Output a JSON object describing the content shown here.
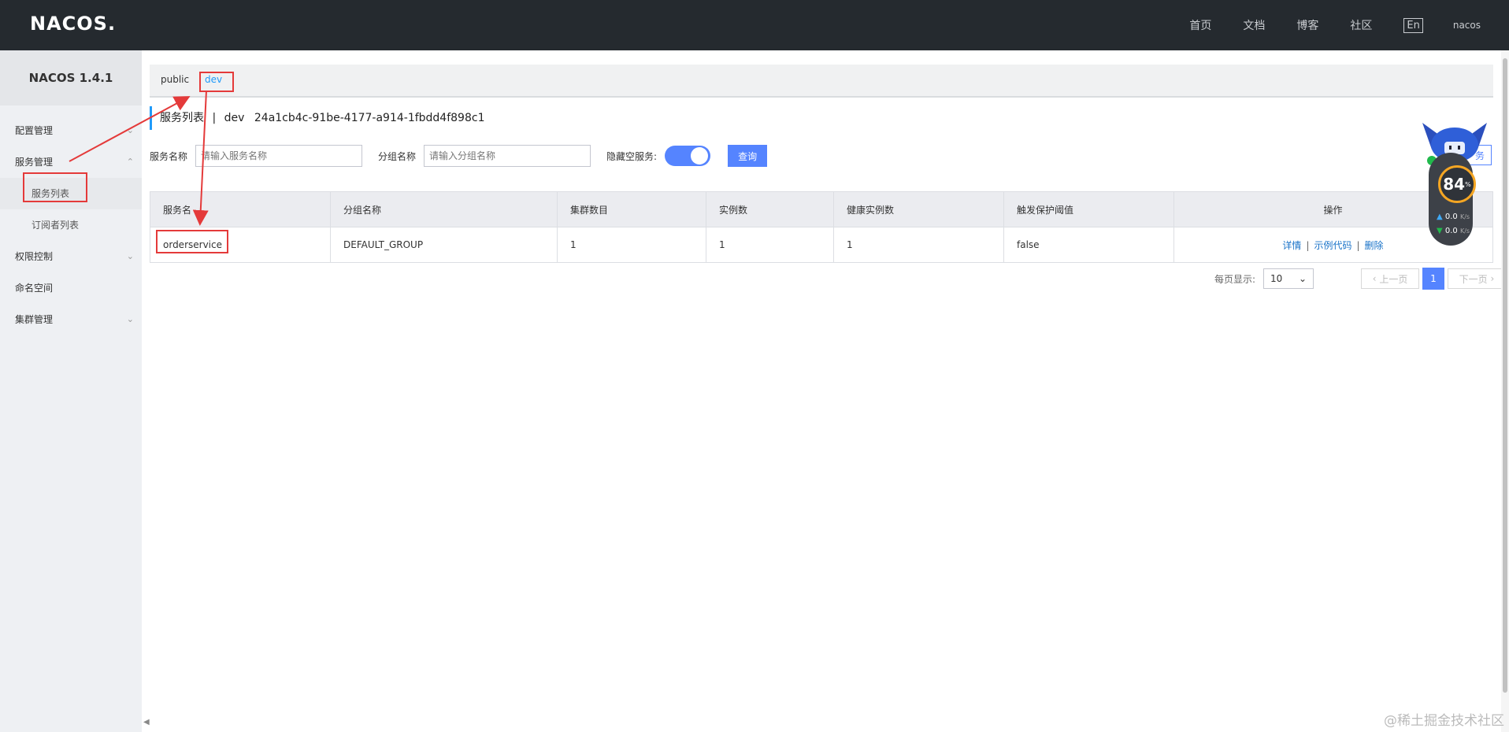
{
  "header": {
    "logo": "NACOS.",
    "nav": [
      "首页",
      "文档",
      "博客",
      "社区"
    ],
    "lang": "En",
    "user": "nacos"
  },
  "sidebar": {
    "title": "NACOS 1.4.1",
    "items": [
      {
        "label": "配置管理",
        "chevron": "⌄"
      },
      {
        "label": "服务管理",
        "chevron": "⌃"
      },
      {
        "label": "服务列表"
      },
      {
        "label": "订阅者列表"
      },
      {
        "label": "权限控制",
        "chevron": "⌄"
      },
      {
        "label": "命名空间"
      },
      {
        "label": "集群管理",
        "chevron": "⌄"
      }
    ]
  },
  "namespaces": {
    "public": "public",
    "dev": "dev"
  },
  "page": {
    "title": "服务列表",
    "sep": "|",
    "ns_name": "dev",
    "ns_id": "24a1cb4c-91be-4177-a914-1fbdd4f898c1"
  },
  "filters": {
    "service_label": "服务名称",
    "service_placeholder": "请输入服务名称",
    "group_label": "分组名称",
    "group_placeholder": "请输入分组名称",
    "hide_empty_label": "隐藏空服务:",
    "query_button": "查询",
    "create_button": "务"
  },
  "table": {
    "headers": [
      "服务名",
      "分组名称",
      "集群数目",
      "实例数",
      "健康实例数",
      "触发保护阈值",
      "操作"
    ],
    "rows": [
      {
        "service": "orderservice",
        "group": "DEFAULT_GROUP",
        "clusters": "1",
        "instances": "1",
        "healthy": "1",
        "threshold": "false",
        "ops": [
          "详情",
          "示例代码",
          "删除"
        ]
      }
    ],
    "op_sep": "|"
  },
  "pagination": {
    "per_page_label": "每页显示:",
    "per_page": "10",
    "prev": "上一页",
    "current": "1",
    "next": "下一页"
  },
  "widget": {
    "percent": "84",
    "percent_unit": "%",
    "up": "0.0",
    "down": "0.0",
    "unit": "K/s"
  },
  "watermark": "@稀土掘金技术社区",
  "colors": {
    "accent": "#5584ff",
    "annotation": "#e43a3a",
    "topbar": "#252a2f"
  }
}
